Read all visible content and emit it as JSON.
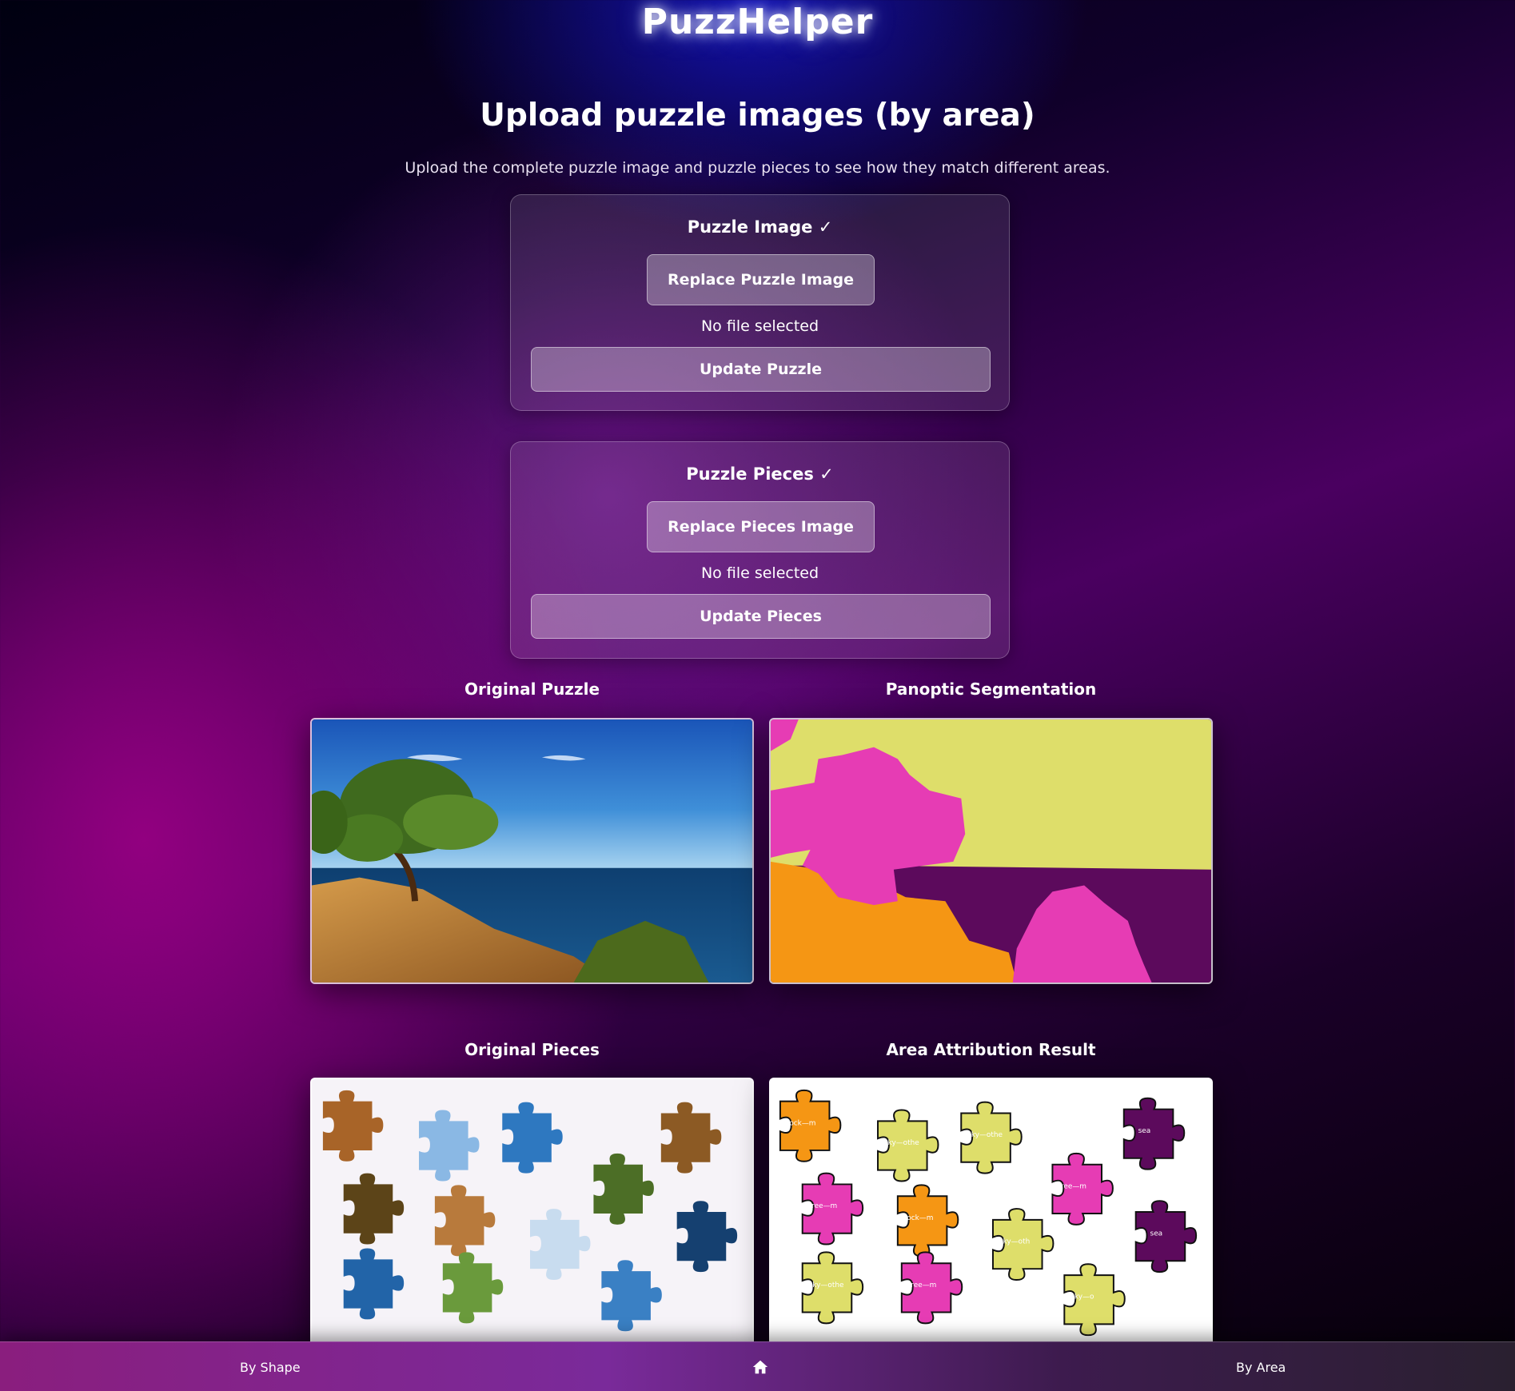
{
  "app": {
    "logo": "PuzzHelper"
  },
  "header": {
    "title": "Upload puzzle images (by area)",
    "subtitle": "Upload the complete puzzle image and puzzle pieces to see how they match different areas."
  },
  "puzzle_card": {
    "title": "Puzzle Image ✓",
    "replace_label": "Replace Puzzle Image",
    "file_status": "No file selected",
    "update_label": "Update Puzzle"
  },
  "pieces_card": {
    "title": "Puzzle Pieces ✓",
    "replace_label": "Replace Pieces Image",
    "file_status": "No file selected",
    "update_label": "Update Pieces"
  },
  "panels": {
    "original_puzzle": "Original Puzzle",
    "panoptic": "Panoptic Segmentation",
    "original_pieces": "Original Pieces",
    "area_result": "Area Attribution Result"
  },
  "result_piece_labels": [
    "rock—m",
    "sky—othe",
    "sky—othe",
    "sea",
    "tree—m",
    "tree—m",
    "rock—m",
    "sky—oth",
    "sea",
    "sky—othe",
    "tree—m",
    "sky—o"
  ],
  "segmentation_colors": {
    "sky": "#dede6a",
    "tree": "#e63cb4",
    "rock": "#f59614",
    "sea": "#5c0a5c"
  },
  "bottom_nav": {
    "by_shape": "By Shape",
    "home_icon": "home-icon",
    "by_area": "By Area"
  }
}
